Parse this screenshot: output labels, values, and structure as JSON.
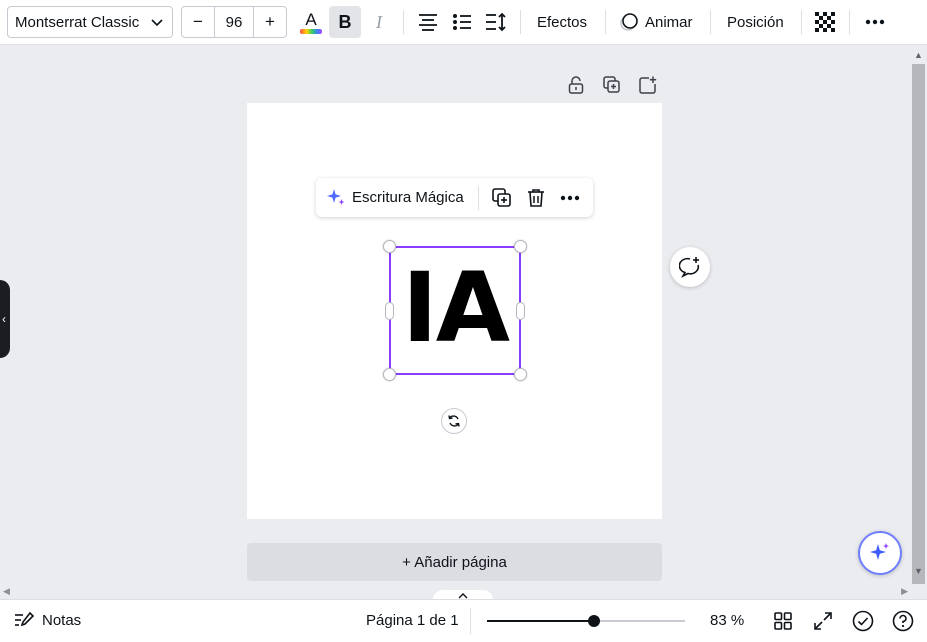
{
  "toolbar": {
    "font_name": "Montserrat Classic",
    "font_size": "96",
    "decrease_label": "−",
    "increase_label": "+",
    "bold_label": "B",
    "italic_label": "I",
    "text_color_letter": "A",
    "effects_label": "Efectos",
    "animate_label": "Animar",
    "position_label": "Posición"
  },
  "canvas": {
    "element_text": "IA",
    "context_menu": {
      "magic_write_label": "Escritura Mágica"
    },
    "add_page_label": "+ Añadir página"
  },
  "footer": {
    "notes_label": "Notas",
    "page_info": "Página 1 de 1",
    "zoom_label": "83 %",
    "zoom_level": 0.54
  },
  "colors": {
    "accent": "#8b3dff",
    "magic_blue": "#6f7dff"
  },
  "icons": [
    "chevron-down-icon",
    "text-color-icon",
    "align-center-icon",
    "list-icon",
    "line-spacing-icon",
    "animate-icon",
    "transparency-icon",
    "more-icon",
    "lock-icon",
    "duplicate-icon",
    "add-page-icon",
    "sparkle-icon",
    "trash-icon",
    "rotate-icon",
    "add-comment-icon",
    "notes-icon",
    "grid-view-icon",
    "fullscreen-icon",
    "check-circle-icon",
    "help-icon"
  ]
}
